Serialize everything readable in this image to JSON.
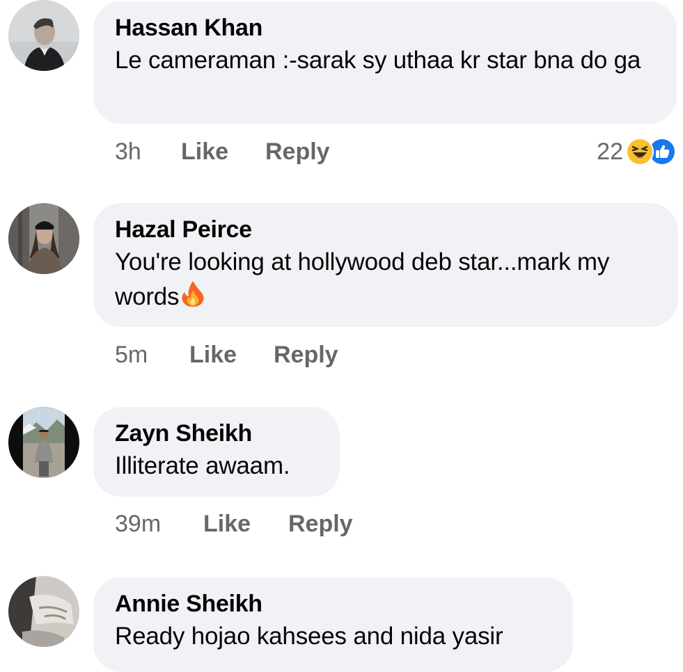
{
  "comments": [
    {
      "author": "Hassan Khan",
      "text": "Le cameraman :-sarak sy uthaa kr star bna do ga",
      "time": "3h",
      "like_label": "Like",
      "reply_label": "Reply",
      "reaction_count": "22",
      "reactions": [
        "haha-icon",
        "like-icon"
      ]
    },
    {
      "author": "Hazal Peirce",
      "text": "You're looking at hollywood deb star...mark my words",
      "emoji": "fire-emoji-icon",
      "time": "5m",
      "like_label": "Like",
      "reply_label": "Reply"
    },
    {
      "author": "Zayn Sheikh",
      "text": "Illiterate awaam.",
      "time": "39m",
      "like_label": "Like",
      "reply_label": "Reply"
    },
    {
      "author": "Annie Sheikh",
      "text": "Ready hojao kahsees and nida yasir"
    }
  ],
  "colors": {
    "bubble": "#f0f2f5",
    "meta_text": "#65676b",
    "primary_text": "#050505",
    "like_blue": "#1877f2",
    "haha_yellow": "#f7c12e"
  }
}
